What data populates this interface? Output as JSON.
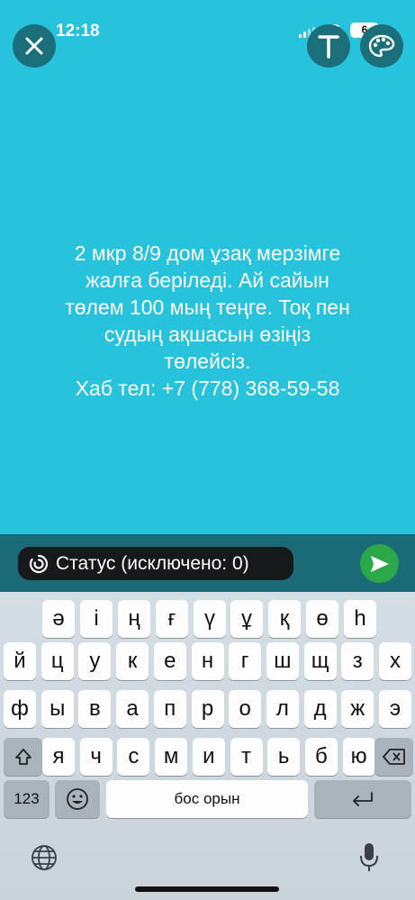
{
  "status_bar": {
    "time": "12:18",
    "network": "4G",
    "battery": "6"
  },
  "toolbar": {
    "close_icon": "close-icon",
    "text_icon": "text-tool-icon",
    "palette_icon": "palette-icon"
  },
  "story": {
    "lines": [
      "2 мкр 8/9 дом ұзақ мерзімге",
      "жалға беріледі. Ай сайын",
      "төлем 100 мың теңге. Тоқ пен",
      "судың ақшасын өзіңіз",
      "төлейсіз.",
      "Хаб тел: +7 (778) 368-59-58"
    ],
    "background_color": "#27c2dc"
  },
  "composer": {
    "status_label": "Статус (исключено: 0)",
    "send_color": "#2ba84a"
  },
  "keyboard": {
    "row1": [
      "ә",
      "і",
      "ң",
      "ғ",
      "ү",
      "ұ",
      "қ",
      "ө",
      "һ"
    ],
    "row2": [
      "й",
      "ц",
      "у",
      "к",
      "е",
      "н",
      "г",
      "ш",
      "щ",
      "з",
      "х"
    ],
    "row3": [
      "ф",
      "ы",
      "в",
      "а",
      "п",
      "р",
      "о",
      "л",
      "д",
      "ж",
      "э"
    ],
    "row4": [
      "я",
      "ч",
      "с",
      "м",
      "и",
      "т",
      "ь",
      "б",
      "ю"
    ],
    "numbers_label": "123",
    "space_label": "бос орын"
  }
}
